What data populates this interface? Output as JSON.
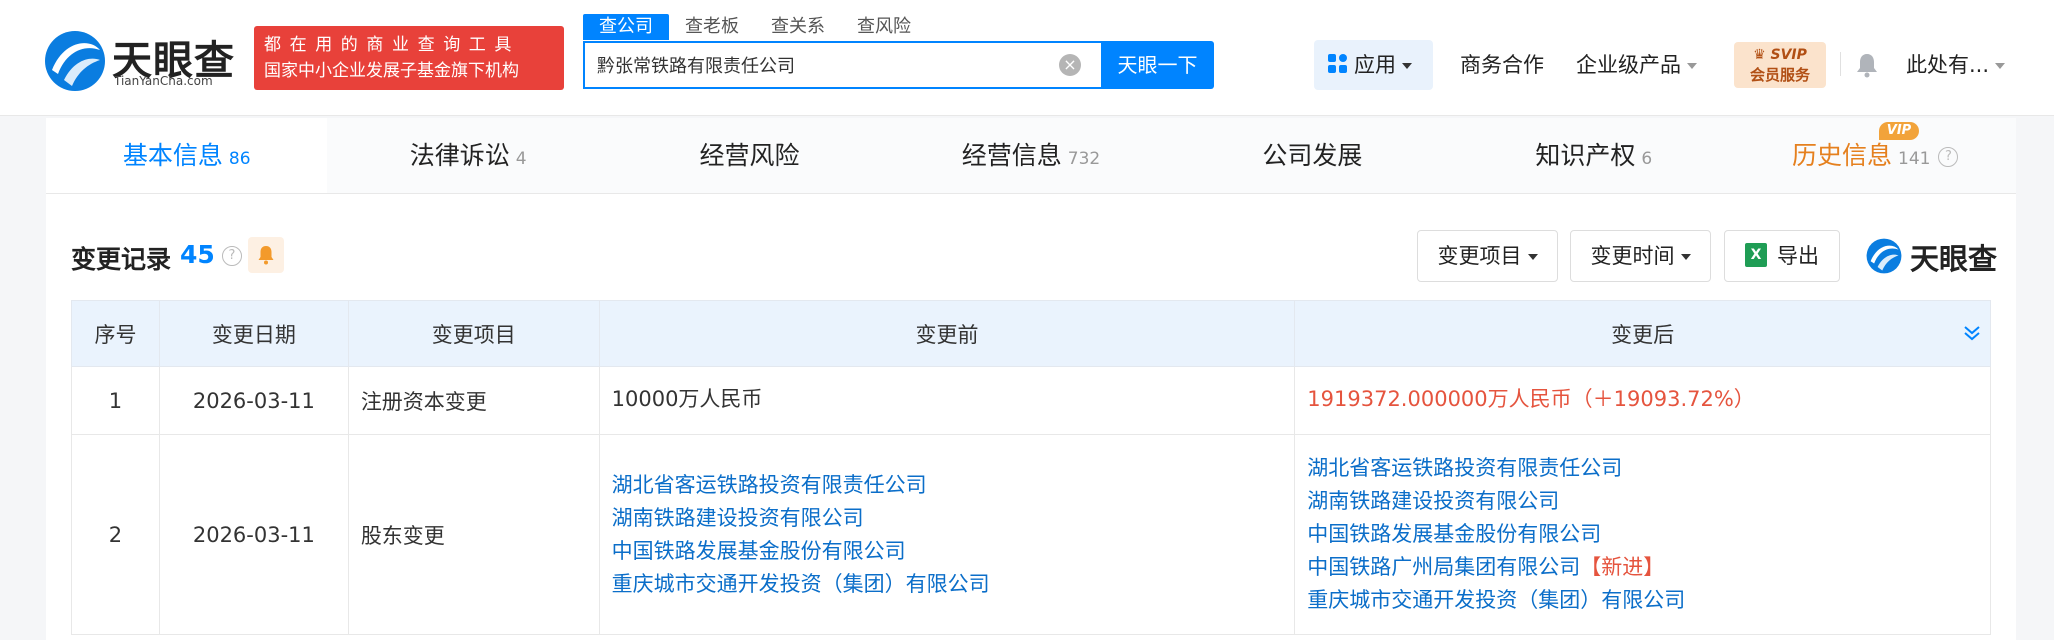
{
  "header": {
    "logo_cn": "天眼查",
    "logo_en": "TianYanCha.com",
    "slogan_line1": "都在用的商业查询工具",
    "slogan_line2": "国家中小企业发展子基金旗下机构",
    "search_tabs": [
      "查公司",
      "查老板",
      "查关系",
      "查风险"
    ],
    "search_value": "黔张常铁路有限责任公司",
    "search_button": "天眼一下",
    "apps_label": "应用",
    "business_label": "商务合作",
    "enterprise_label": "企业级产品",
    "svip_line1": "SVIP",
    "svip_line2": "会员服务",
    "user_label": "此处有..."
  },
  "tabs": [
    {
      "label": "基本信息",
      "count": "86"
    },
    {
      "label": "法律诉讼",
      "count": "4"
    },
    {
      "label": "经营风险",
      "count": ""
    },
    {
      "label": "经营信息",
      "count": "732"
    },
    {
      "label": "公司发展",
      "count": ""
    },
    {
      "label": "知识产权",
      "count": "6"
    },
    {
      "label": "历史信息",
      "count": "141"
    }
  ],
  "vip_badge": "VIP",
  "section": {
    "title": "变更记录",
    "count": "45",
    "filter_item": "变更项目",
    "filter_time": "变更时间",
    "export": "导出",
    "watermark": "天眼查"
  },
  "table": {
    "headers": [
      "序号",
      "变更日期",
      "变更项目",
      "变更前",
      "变更后"
    ],
    "rows": [
      {
        "no": "1",
        "date": "2026-03-11",
        "item": "注册资本变更",
        "before": "10000万人民币",
        "after": "1919372.000000万人民币（＋19093.72%）"
      },
      {
        "no": "2",
        "date": "2026-03-11",
        "item": "股东变更",
        "before": [
          "湖北省客运铁路投资有限责任公司",
          "湖南铁路建设投资有限公司",
          "中国铁路发展基金股份有限公司",
          "重庆城市交通开发投资（集团）有限公司"
        ],
        "after": [
          "湖北省客运铁路投资有限责任公司",
          "湖南铁路建设投资有限公司",
          "中国铁路发展基金股份有限公司",
          "中国铁路广州局集团有限公司",
          "重庆城市交通开发投资（集团）有限公司"
        ],
        "new_tag": "【新进】"
      }
    ]
  },
  "colors": {
    "accent": "#0084ff",
    "red": "#e5543e",
    "history": "#e5801e"
  }
}
